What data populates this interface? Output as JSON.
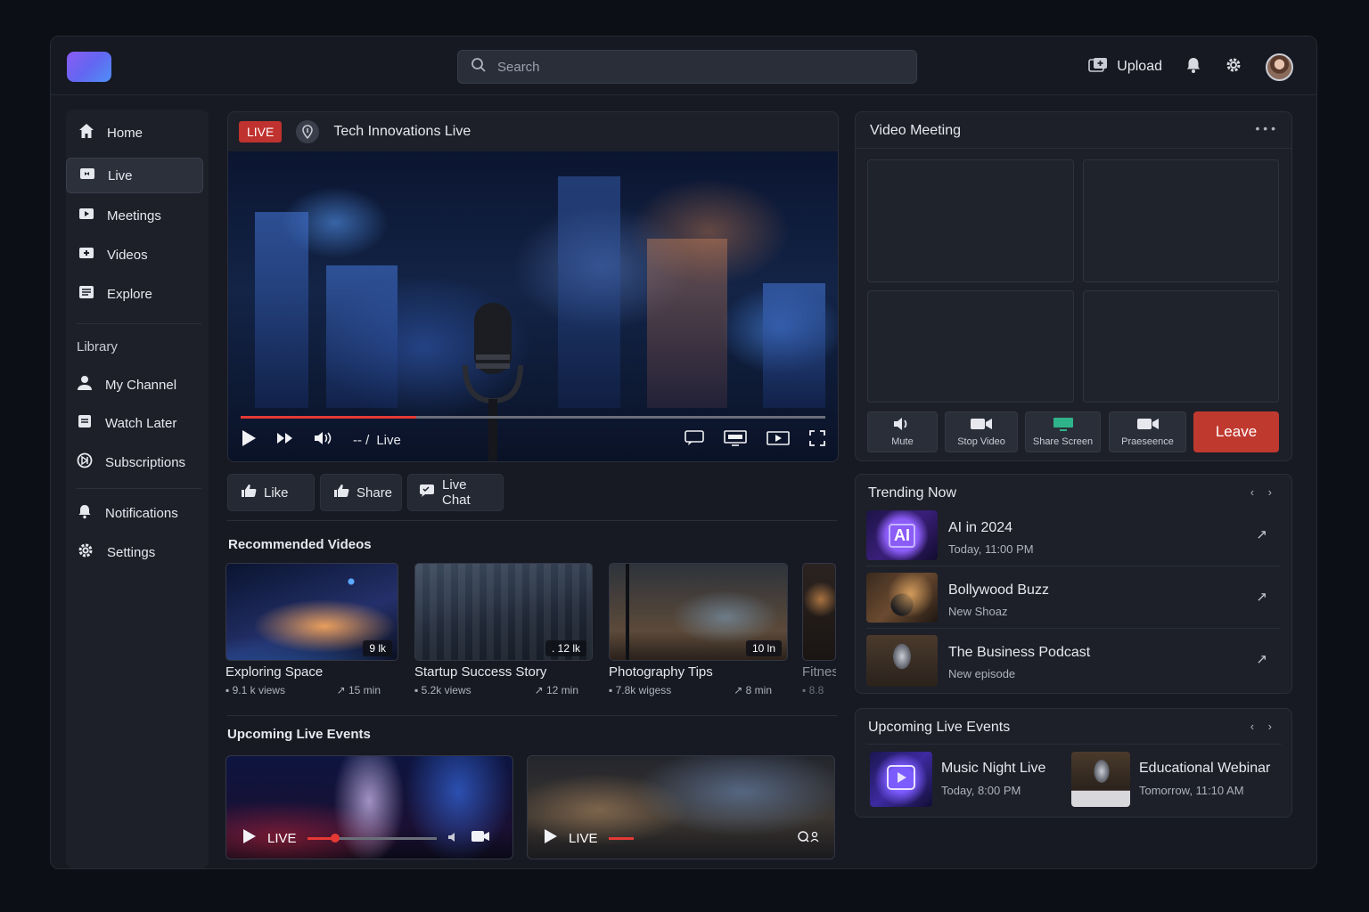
{
  "search": {
    "placeholder": "Search"
  },
  "header": {
    "upload_label": "Upload"
  },
  "sidebar": {
    "main": [
      {
        "label": "Home",
        "icon": "home-icon"
      },
      {
        "label": "Live",
        "icon": "live-icon"
      },
      {
        "label": "Meetings",
        "icon": "meetings-icon"
      },
      {
        "label": "Videos",
        "icon": "videos-icon"
      },
      {
        "label": "Explore",
        "icon": "explore-icon"
      }
    ],
    "library_heading": "Library",
    "library": [
      {
        "label": "My Channel",
        "icon": "user-icon"
      },
      {
        "label": "Watch Later",
        "icon": "watch-later-icon"
      },
      {
        "label": "Subscriptions",
        "icon": "subscriptions-icon"
      }
    ],
    "bottom": [
      {
        "label": "Notifications",
        "icon": "bell-icon"
      },
      {
        "label": "Settings",
        "icon": "gear-icon"
      }
    ]
  },
  "player": {
    "badge": "LIVE",
    "title": "Tech Innovations Live",
    "time": "-- /",
    "status": "Live",
    "progress": 0.3
  },
  "actions": {
    "like": "Like",
    "share": "Share",
    "live_chat": "Live Chat"
  },
  "recommended": {
    "heading": "Recommended Videos",
    "items": [
      {
        "title": "Exploring Space",
        "count": "9 lk",
        "views": "9.1 k views",
        "duration": "15 min"
      },
      {
        "title": "Startup Success Story",
        "count": ". 12 lk",
        "views": "5.2k views",
        "duration": "12 min"
      },
      {
        "title": "Photography Tips",
        "count": "10 ln",
        "views": "7.8k wigess",
        "duration": "8 min"
      },
      {
        "title": "Fitnes",
        "count": "",
        "views": "8.8",
        "duration": ""
      }
    ]
  },
  "upcoming_left": {
    "heading": "Upcoming Live Events",
    "items": [
      {
        "label": "LIVE"
      },
      {
        "label": "LIVE"
      }
    ]
  },
  "meeting": {
    "title": "Video Meeting",
    "menu": "• • •",
    "controls": [
      {
        "label": "Mute",
        "icon": "speaker-icon"
      },
      {
        "label": "Stop Video",
        "icon": "camera-icon"
      },
      {
        "label": "Share Screen",
        "icon": "share-screen-icon"
      },
      {
        "label": "Praeseence",
        "icon": "presence-icon"
      }
    ],
    "leave": "Leave"
  },
  "trending": {
    "heading": "Trending Now",
    "arrows": "‹ ›",
    "items": [
      {
        "title": "AI in 2024",
        "sub": "Today, 11:00 PM"
      },
      {
        "title": "Bollywood Buzz",
        "sub": "New Shoaz"
      },
      {
        "title": "The Business Podcast",
        "sub": "New episode"
      }
    ]
  },
  "upcoming_right": {
    "heading": "Upcoming Live Events",
    "arrows": "‹ ›",
    "items": [
      {
        "title": "Music Night Live",
        "sub": "Today, 8:00 PM"
      },
      {
        "title": "Educational Webinar",
        "sub": "Tomorrow, 11:10 AM"
      }
    ]
  },
  "colors": {
    "accent_red": "#c0392f",
    "live_red": "#e53935",
    "logo": "#7b61f5"
  }
}
